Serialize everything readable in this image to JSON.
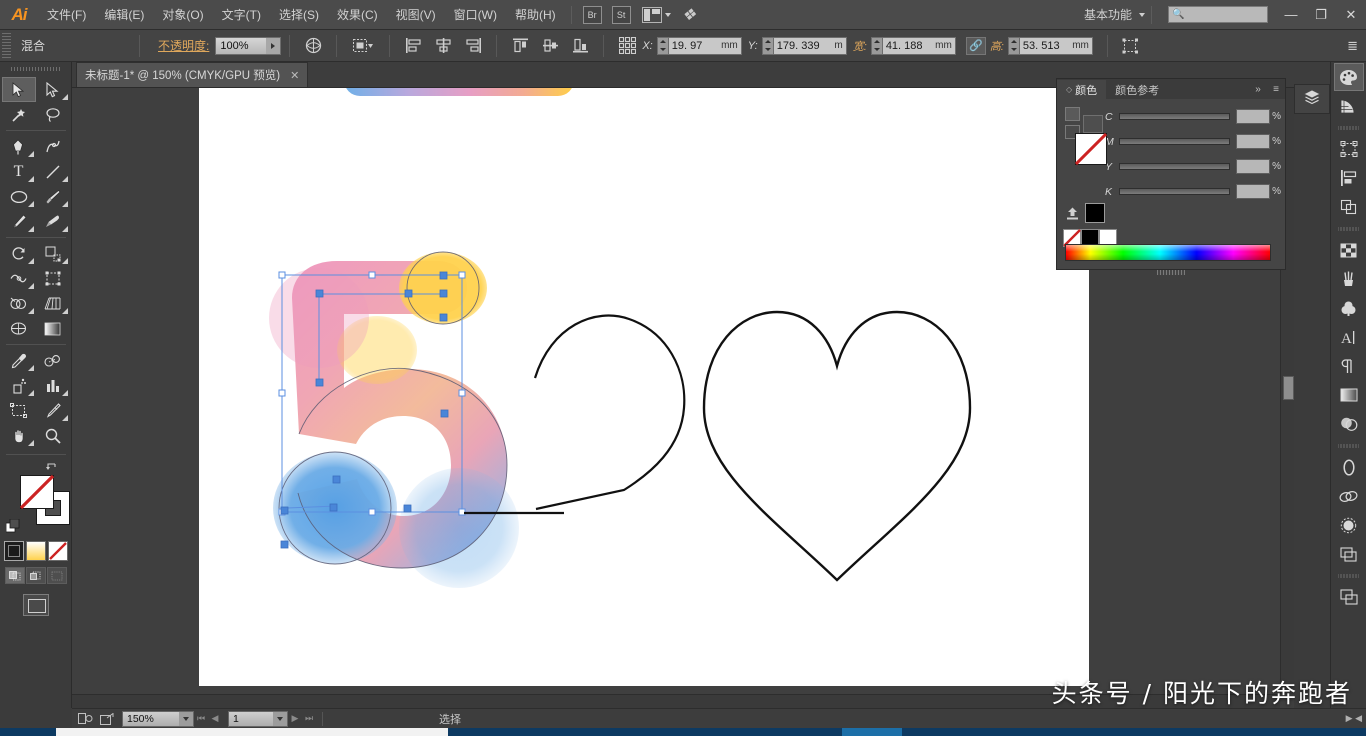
{
  "app": {
    "name": "Adobe Illustrator",
    "logo_text": "Ai"
  },
  "menubar": {
    "items": [
      {
        "label": "文件(F)",
        "name": "menu-file"
      },
      {
        "label": "编辑(E)",
        "name": "menu-edit"
      },
      {
        "label": "对象(O)",
        "name": "menu-object"
      },
      {
        "label": "文字(T)",
        "name": "menu-type"
      },
      {
        "label": "选择(S)",
        "name": "menu-select"
      },
      {
        "label": "效果(C)",
        "name": "menu-effect"
      },
      {
        "label": "视图(V)",
        "name": "menu-view"
      },
      {
        "label": "窗口(W)",
        "name": "menu-window"
      },
      {
        "label": "帮助(H)",
        "name": "menu-help"
      }
    ],
    "bridge_label": "Br",
    "stock_label": "St",
    "workspace": "基本功能",
    "search_placeholder": "",
    "search_value": "",
    "minimize": "—",
    "restore": "❐",
    "close": "✕"
  },
  "controlbar": {
    "selection_label": "混合",
    "opacity_label": "不透明度:",
    "opacity_value": "100%",
    "x_label": "X:",
    "x_value": "19. 97",
    "x_unit": "mm",
    "y_label": "Y:",
    "y_value": "179. 339",
    "y_unit": "m",
    "w_label": "宽:",
    "w_value": "41. 188",
    "w_unit": "mm",
    "h_label": "高:",
    "h_value": "53. 513",
    "h_unit": "mm",
    "link_label": "链接宽度和高度比例",
    "transform_label": "变换"
  },
  "tab": {
    "title": "未标题-1* @ 150% (CMYK/GPU 预览)",
    "close": "✕"
  },
  "toolbar": {
    "tools": [
      {
        "name": "selection-tool",
        "glyph": "selection",
        "active": true,
        "more": false
      },
      {
        "name": "direct-selection-tool",
        "glyph": "direct-selection",
        "active": false,
        "more": true
      },
      {
        "name": "magic-wand-tool",
        "glyph": "magic-wand",
        "active": false,
        "more": false
      },
      {
        "name": "lasso-tool",
        "glyph": "lasso",
        "active": false,
        "more": false
      },
      {
        "name": "pen-tool",
        "glyph": "pen",
        "active": false,
        "more": true
      },
      {
        "name": "curvature-tool",
        "glyph": "curvature",
        "active": false,
        "more": false
      },
      {
        "name": "type-tool",
        "glyph": "type",
        "active": false,
        "more": true
      },
      {
        "name": "line-segment-tool",
        "glyph": "line",
        "active": false,
        "more": true
      },
      {
        "name": "ellipse-tool",
        "glyph": "ellipse",
        "active": false,
        "more": true
      },
      {
        "name": "paintbrush-tool",
        "glyph": "paintbrush",
        "active": false,
        "more": true
      },
      {
        "name": "pencil-tool",
        "glyph": "pencil",
        "active": false,
        "more": true
      },
      {
        "name": "blob-brush-tool",
        "glyph": "blob-brush",
        "active": false,
        "more": false
      },
      {
        "name": "rotate-tool",
        "glyph": "rotate",
        "active": false,
        "more": true
      },
      {
        "name": "scale-tool",
        "glyph": "scale",
        "active": false,
        "more": true
      },
      {
        "name": "width-tool",
        "glyph": "width",
        "active": false,
        "more": true
      },
      {
        "name": "free-transform-tool",
        "glyph": "free-transform",
        "active": false,
        "more": false
      },
      {
        "name": "shape-builder-tool",
        "glyph": "shape-builder",
        "active": false,
        "more": true
      },
      {
        "name": "perspective-grid-tool",
        "glyph": "perspective-grid",
        "active": false,
        "more": true
      },
      {
        "name": "mesh-tool",
        "glyph": "mesh",
        "active": false,
        "more": false
      },
      {
        "name": "gradient-tool",
        "glyph": "gradient",
        "active": false,
        "more": false
      },
      {
        "name": "eyedropper-tool",
        "glyph": "eyedropper",
        "active": false,
        "more": true
      },
      {
        "name": "blend-tool",
        "glyph": "blend",
        "active": false,
        "more": false
      },
      {
        "name": "symbol-sprayer-tool",
        "glyph": "symbol-sprayer",
        "active": false,
        "more": true
      },
      {
        "name": "column-graph-tool",
        "glyph": "column-graph",
        "active": false,
        "more": true
      },
      {
        "name": "artboard-tool",
        "glyph": "artboard",
        "active": false,
        "more": false
      },
      {
        "name": "slice-tool",
        "glyph": "slice",
        "active": false,
        "more": true
      },
      {
        "name": "hand-tool",
        "glyph": "hand",
        "active": false,
        "more": true
      },
      {
        "name": "zoom-tool",
        "glyph": "zoom",
        "active": false,
        "more": false
      }
    ],
    "fill_label": "填色",
    "stroke_label": "描边",
    "swap_label": "互换填色和描边",
    "default_label": "默认填色和描边",
    "modes": [
      {
        "name": "color-mode-button",
        "label": "颜色"
      },
      {
        "name": "gradient-mode-button",
        "label": "渐变"
      },
      {
        "name": "none-mode-button",
        "label": "无"
      }
    ],
    "draw_modes": [
      {
        "name": "draw-normal-button",
        "label": "正常绘图",
        "selected": true
      },
      {
        "name": "draw-behind-button",
        "label": "背面绘图",
        "selected": false
      },
      {
        "name": "draw-inside-button",
        "label": "内部绘图",
        "selected": false
      }
    ],
    "screen_mode_label": "更改屏幕模式"
  },
  "color_panel": {
    "tabs": [
      {
        "label": "颜色",
        "active": true,
        "name": "tab-color"
      },
      {
        "label": "颜色参考",
        "active": false,
        "name": "tab-color-guide"
      }
    ],
    "collapse_label": "»",
    "menu_label": "≡",
    "sliders": [
      {
        "label": "C",
        "value": "",
        "unit": "%"
      },
      {
        "label": "M",
        "value": "",
        "unit": "%"
      },
      {
        "label": "Y",
        "value": "",
        "unit": "%"
      },
      {
        "label": "K",
        "value": "",
        "unit": "%"
      }
    ],
    "fill_color": "#ffffff",
    "stroke_color": "#000000",
    "none_label": "无"
  },
  "right_dock": {
    "icons": [
      {
        "name": "color-panel-icon",
        "glyph": "palette",
        "active": true
      },
      {
        "name": "color-guide-icon",
        "glyph": "color-guide",
        "active": false
      },
      {
        "name": "transform-panel-icon",
        "glyph": "transform",
        "active": false
      },
      {
        "name": "align-panel-icon",
        "glyph": "align",
        "active": false
      },
      {
        "name": "pathfinder-panel-icon",
        "glyph": "pathfinder",
        "active": false
      },
      {
        "name": "transparency-panel-icon",
        "glyph": "grid",
        "active": false
      },
      {
        "name": "brushes-panel-icon",
        "glyph": "brushes",
        "active": false
      },
      {
        "name": "symbols-panel-icon",
        "glyph": "symbols",
        "active": false
      },
      {
        "name": "character-panel-icon",
        "glyph": "character",
        "active": false
      },
      {
        "name": "paragraph-panel-icon",
        "glyph": "paragraph",
        "active": false
      },
      {
        "name": "gradient-panel-icon",
        "glyph": "gradient",
        "active": false
      },
      {
        "name": "appearance-panel-icon",
        "glyph": "appearance",
        "active": false
      },
      {
        "name": "stroke-panel-icon",
        "glyph": "stroke",
        "active": false
      },
      {
        "name": "links-panel-icon",
        "glyph": "links",
        "active": false
      },
      {
        "name": "image-trace-panel-icon",
        "glyph": "image-trace",
        "active": false
      },
      {
        "name": "artboards-panel-icon",
        "glyph": "artboards",
        "active": false
      },
      {
        "name": "libraries-panel-icon",
        "glyph": "libraries",
        "active": false
      }
    ],
    "layers_icon": {
      "name": "layers-panel-icon",
      "glyph": "layers"
    }
  },
  "statusbar": {
    "zoom_value": "150%",
    "page_value": "1",
    "status_text": "选择",
    "first_page": "⏮",
    "prev_page": "◀",
    "next_page": "▶",
    "last_page": "⏭"
  },
  "artwork": {
    "description": "520 lettering with heart — the numeral 5 is a gradient blend object, currently selected",
    "selected_object": "numeral-5-blend",
    "shapes": [
      {
        "name": "numeral-5",
        "type": "gradient-blend",
        "selected": true
      },
      {
        "name": "numeral-2",
        "type": "outline-path",
        "selected": false
      },
      {
        "name": "heart-shape",
        "type": "outline-path",
        "selected": false
      },
      {
        "name": "top-gradient-bar",
        "type": "gradient-shape",
        "selected": false
      }
    ],
    "gradient_colors": [
      "#e8a0c0",
      "#f3c2a0",
      "#ffd24d",
      "#f2a6b8",
      "#6aa8e8",
      "#8fb6e8"
    ],
    "stroke_color": "#000000"
  },
  "watermark": {
    "text": "头条号 / 阳光下的奔跑者"
  }
}
